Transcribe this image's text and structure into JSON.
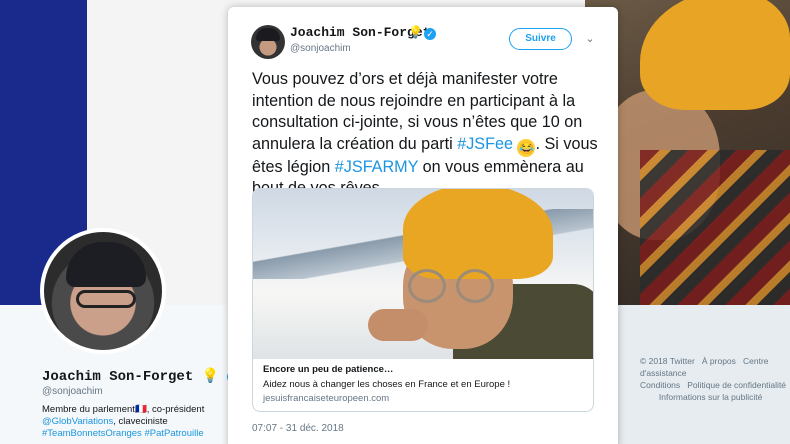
{
  "tweet": {
    "author_name": "Joachim Son-Forget",
    "author_handle": "@sonjoachim",
    "follow_label": "Suivre",
    "text_parts": {
      "p1": "Vous pouvez d’ors et déjà manifester votre intention de nous rejoindre en participant à la consultation ci-jointe, si vous n’êtes que 10 on annulera la création du parti ",
      "hashtag1": "#JSFee",
      "p2": " Si vous êtes légion ",
      "hashtag2": "#JSFARMY",
      "p3": " on vous emmènera au bout de vos rêves."
    },
    "emoji": "😂",
    "card": {
      "title": "Encore un peu de patience…",
      "description": "Aidez nous à changer les choses en France et en Europe !",
      "url": "jesuisfrancaiseteuropeen.com"
    },
    "timestamp": "07:07 - 31 déc. 2018"
  },
  "profile": {
    "name": "Joachim Son-Forget",
    "handle": "@sonjoachim",
    "bio_line1": "Membre du parlement",
    "bio_flag": "🇫🇷",
    "bio_line1b": ", co-président",
    "bio_link": "@GlobVariations",
    "bio_line2": ", claveciniste",
    "bio_tags": "#TeamBonnetsOranges #PatPatrouille"
  },
  "footer": {
    "copyright": "© 2018 Twitter",
    "about": "À propos",
    "help": "Centre d'assistance",
    "conditions": "Conditions",
    "privacy": "Politique de confidentialité",
    "ads": "Informations sur la publicité"
  },
  "colors": {
    "brand_blue": "#1da1f2",
    "hashtag_blue": "#1b95e0",
    "text": "#14171a",
    "muted": "#657786"
  }
}
